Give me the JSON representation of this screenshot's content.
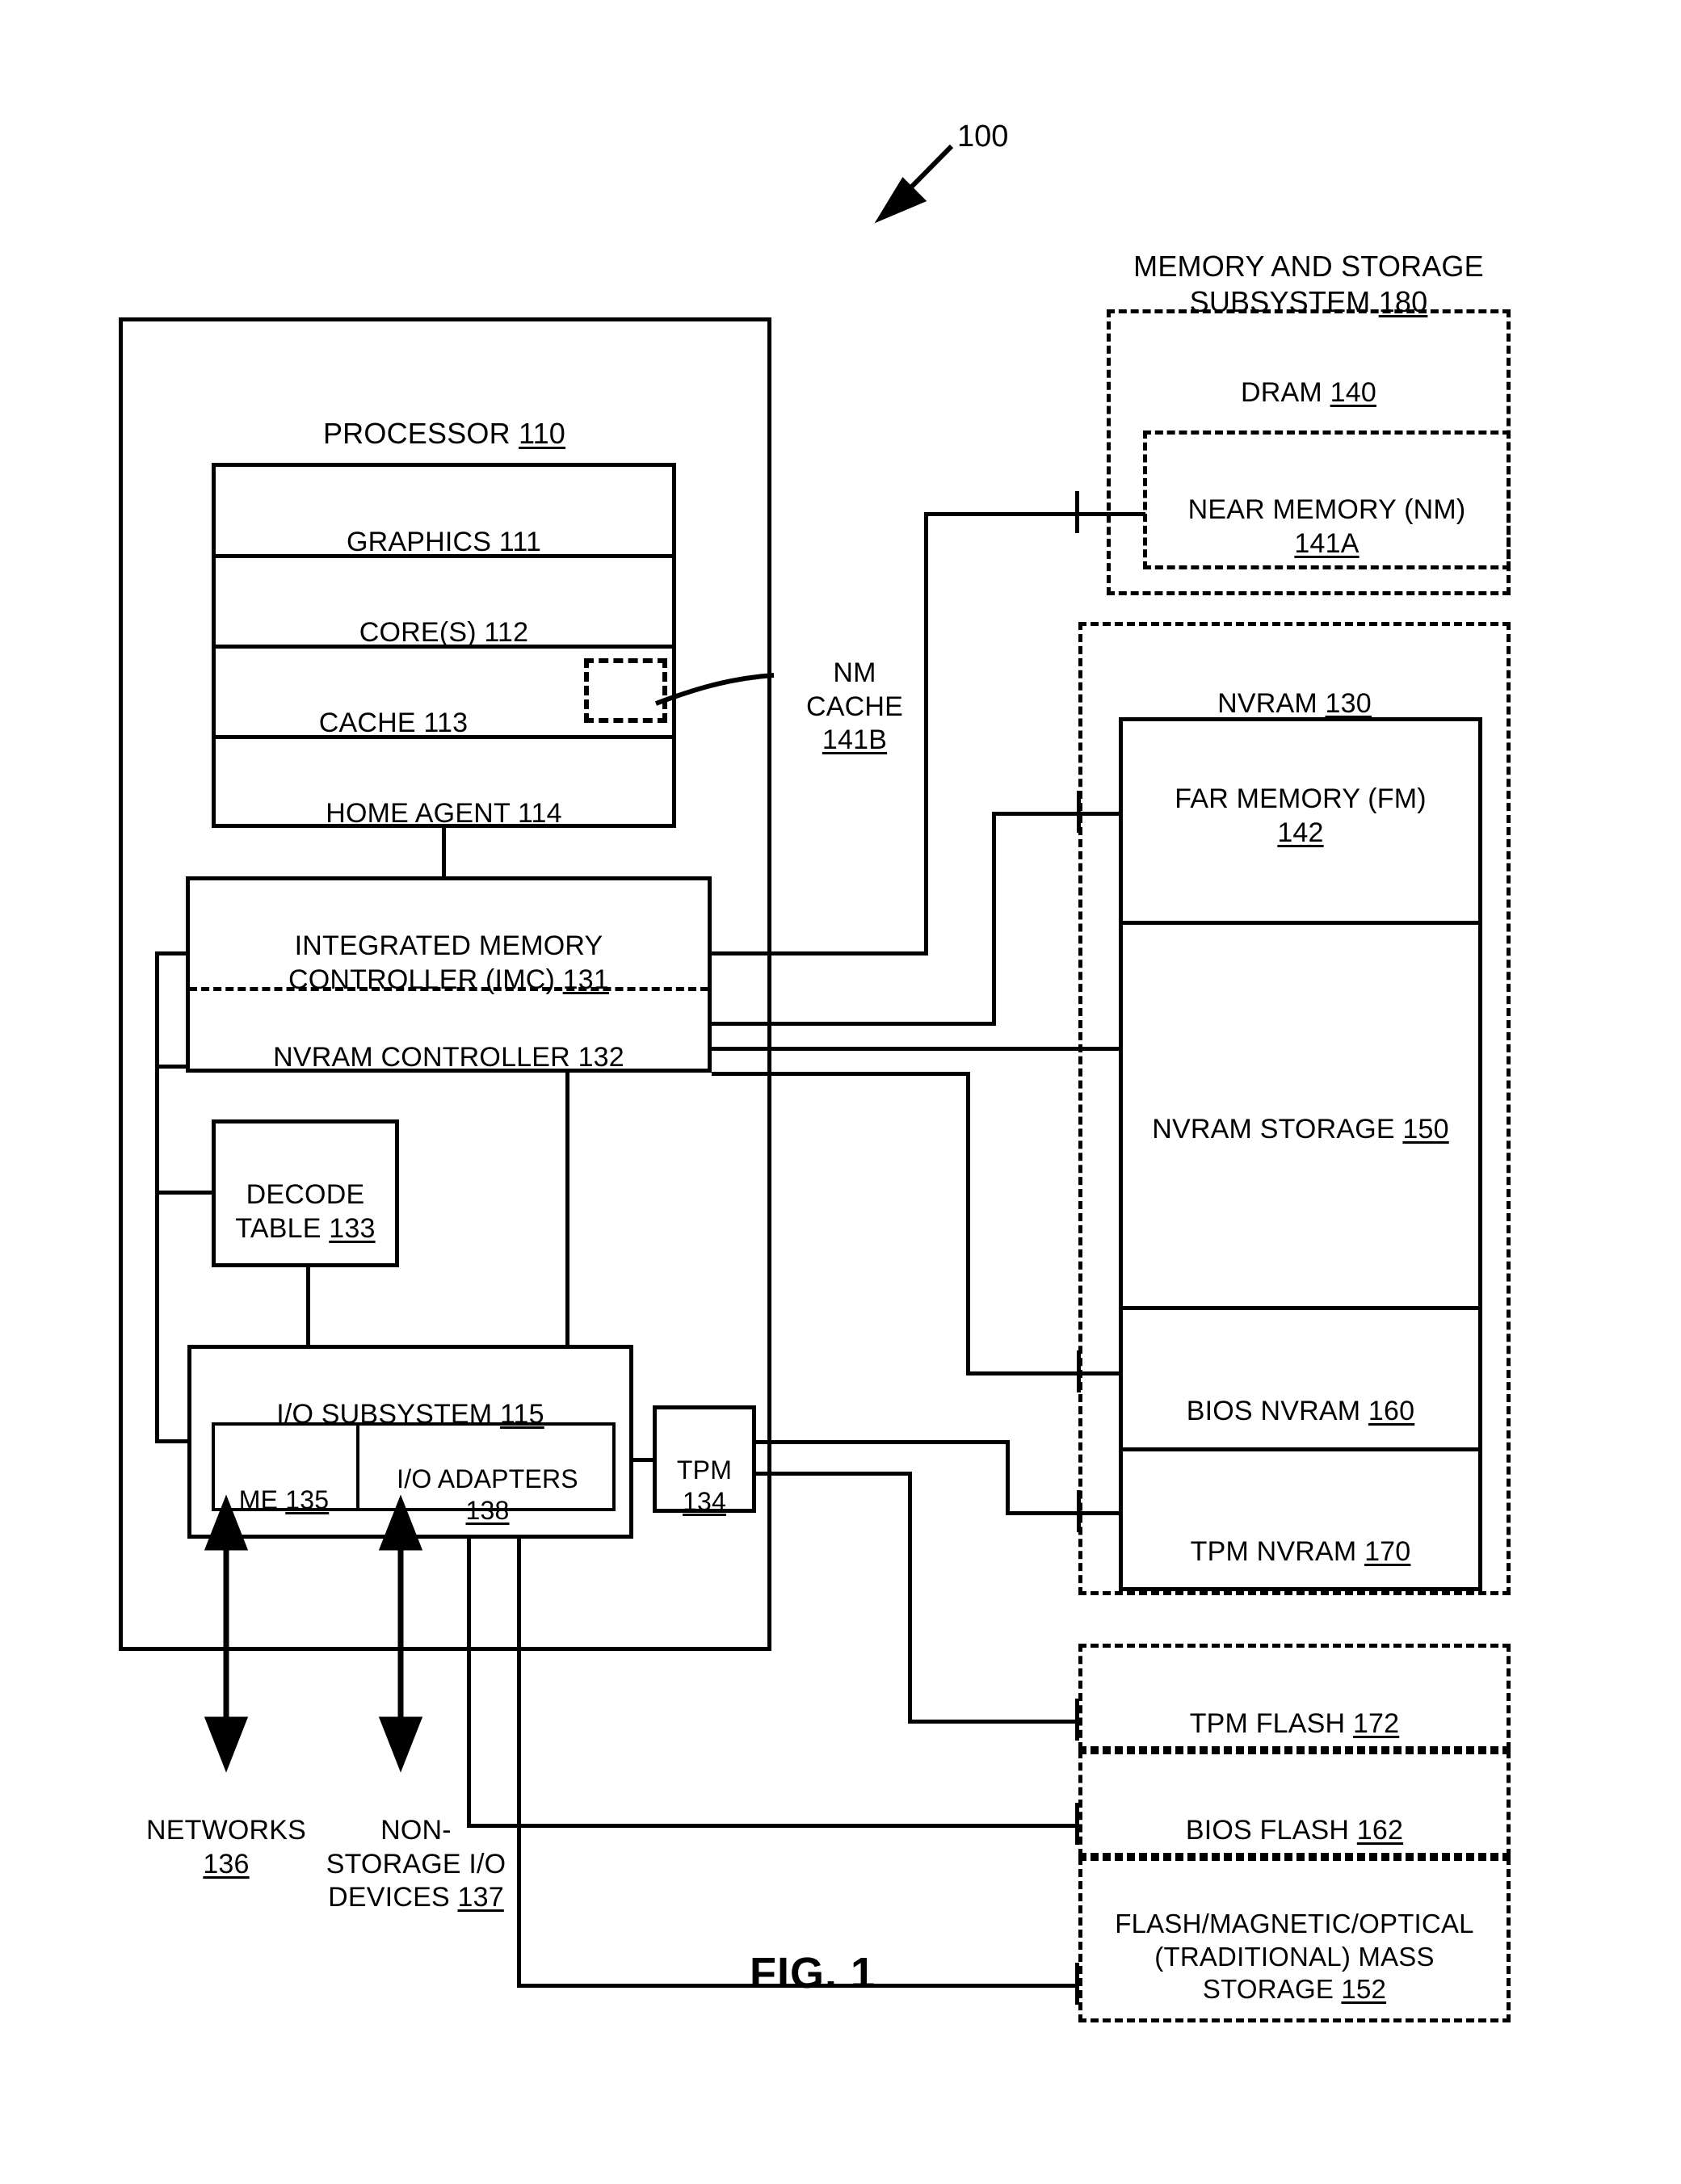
{
  "figure": {
    "caption": "FIG. 1",
    "system_ref": "100"
  },
  "processor": {
    "title": "PROCESSOR ",
    "ref": "110",
    "blocks": [
      {
        "label": "GRAPHICS ",
        "ref": "111"
      },
      {
        "label": "CORE(S) ",
        "ref": "112"
      },
      {
        "label": "CACHE ",
        "ref": "113"
      },
      {
        "label": "HOME AGENT ",
        "ref": "114"
      }
    ],
    "nm_cache_callout": "NM\nCACHE\n",
    "nm_cache_ref": "141B",
    "imc": {
      "label": "INTEGRATED MEMORY\nCONTROLLER (IMC) ",
      "ref": "131"
    },
    "nvram_controller": {
      "label": "NVRAM CONTROLLER ",
      "ref": "132"
    },
    "decode_table": {
      "label": "DECODE\nTABLE ",
      "ref": "133"
    },
    "io_subsystem": {
      "label": "I/O SUBSYSTEM ",
      "ref": "115"
    },
    "me": {
      "label": "ME ",
      "ref": "135"
    },
    "io_adapters": {
      "label": "I/O ADAPTERS\n",
      "ref": "138"
    },
    "tpm": {
      "label": "TPM\n",
      "ref": "134"
    }
  },
  "external_io": [
    {
      "label": "NETWORKS\n",
      "ref": "136"
    },
    {
      "label": "NON-\nSTORAGE I/O\nDEVICES ",
      "ref": "137"
    }
  ],
  "memory_subsystem": {
    "title": "MEMORY AND STORAGE\nSUBSYSTEM ",
    "ref": "180",
    "dram": {
      "label": "DRAM ",
      "ref": "140"
    },
    "near_memory": {
      "label": "NEAR MEMORY (NM)\n",
      "ref": "141A"
    },
    "nvram": {
      "label": "NVRAM ",
      "ref": "130"
    },
    "far_memory": {
      "label": "FAR MEMORY (FM)\n",
      "ref": "142"
    },
    "nvram_storage": {
      "label": "NVRAM STORAGE ",
      "ref": "150"
    },
    "bios_nvram": {
      "label": "BIOS NVRAM ",
      "ref": "160"
    },
    "tpm_nvram": {
      "label": "TPM NVRAM ",
      "ref": "170"
    },
    "tpm_flash": {
      "label": "TPM FLASH ",
      "ref": "172"
    },
    "bios_flash": {
      "label": "BIOS FLASH ",
      "ref": "162"
    },
    "mass_storage": {
      "label": "FLASH/MAGNETIC/OPTICAL\n(TRADITIONAL) MASS\nSTORAGE ",
      "ref": "152"
    }
  },
  "colors": {
    "ink": "#000000",
    "paper": "#ffffff"
  }
}
